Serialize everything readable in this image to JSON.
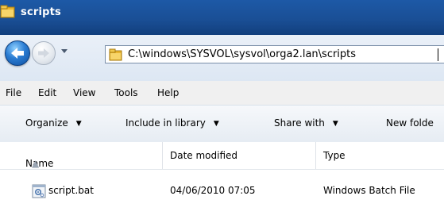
{
  "window": {
    "title": "scripts"
  },
  "address": {
    "path": "C:\\windows\\SYSVOL\\sysvol\\orga2.lan\\scripts"
  },
  "menu": [
    "File",
    "Edit",
    "View",
    "Tools",
    "Help"
  ],
  "commands": [
    "Organize",
    "Include in library",
    "Share with",
    "New folde"
  ],
  "columns": [
    "Name",
    "Date modified",
    "Type"
  ],
  "files": [
    {
      "name": "script.bat",
      "date": "04/06/2010 07:05",
      "type": "Windows Batch File"
    }
  ],
  "colors": {
    "titlebar": "#1a4f96",
    "background": "#ffffff"
  }
}
